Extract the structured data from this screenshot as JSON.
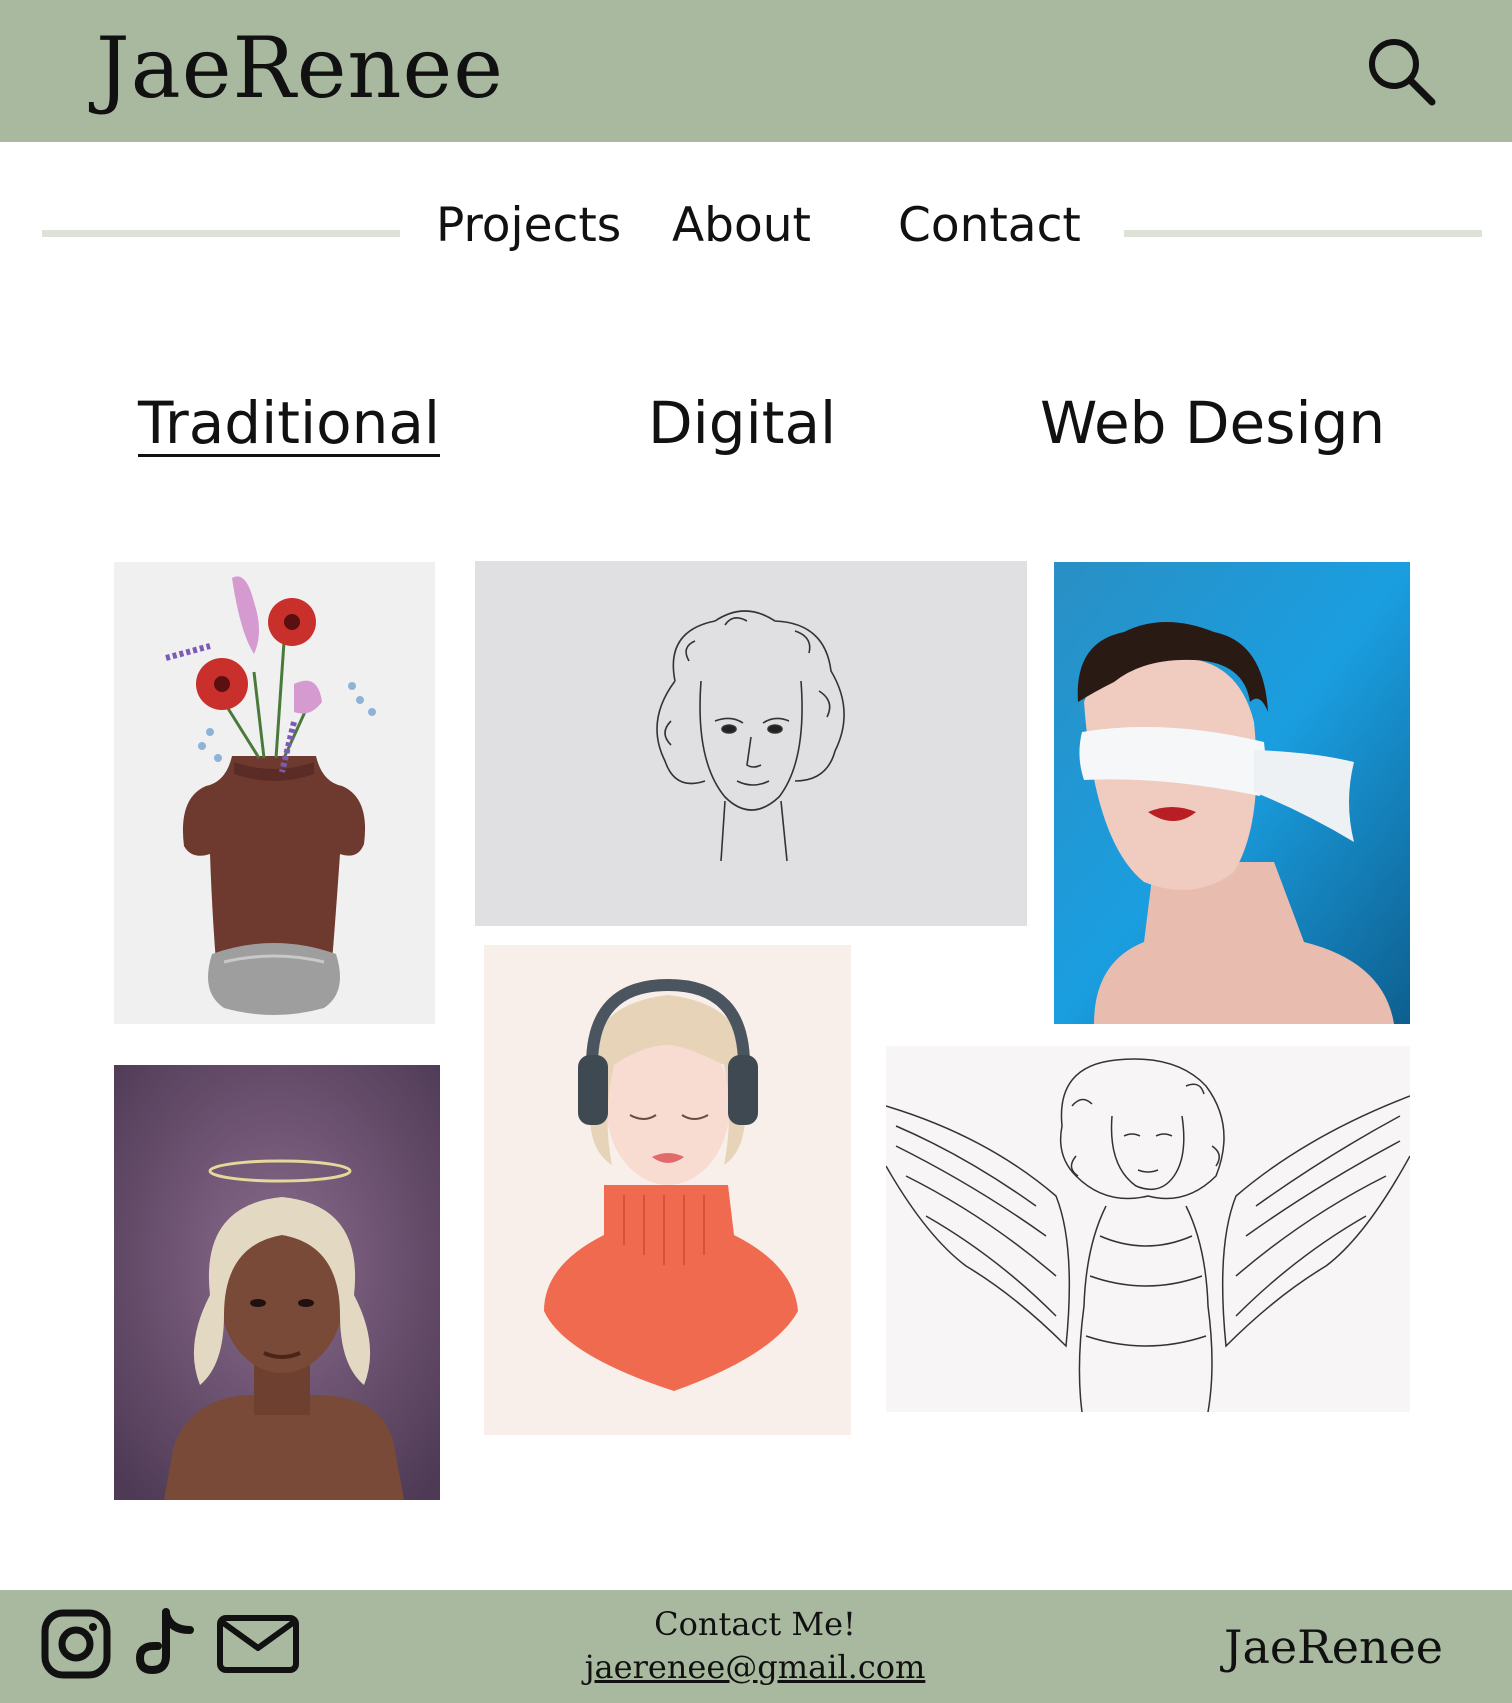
{
  "theme": {
    "brand": "#a8b99f",
    "nav_line": "#dde2d9"
  },
  "header": {
    "logo": "JaeRenee",
    "search_icon": "search-icon"
  },
  "nav": {
    "items": [
      "Projects",
      "About",
      "Contact"
    ]
  },
  "categories": {
    "tabs": [
      "Traditional",
      "Digital",
      "Web Design"
    ],
    "active": "Traditional"
  },
  "gallery": {
    "artworks": [
      {
        "subject": "flower-vase-figure"
      },
      {
        "subject": "curly-hair-sketch"
      },
      {
        "subject": "blindfolded-portrait"
      },
      {
        "subject": "halo-portrait"
      },
      {
        "subject": "headphones-portrait"
      },
      {
        "subject": "winged-figure-sketch"
      }
    ]
  },
  "footer": {
    "social_icons": [
      "instagram-icon",
      "tiktok-icon",
      "mail-icon"
    ],
    "contact_title": "Contact Me!",
    "email": "jaerenee@gmail.com",
    "brand": "JaeRenee"
  }
}
